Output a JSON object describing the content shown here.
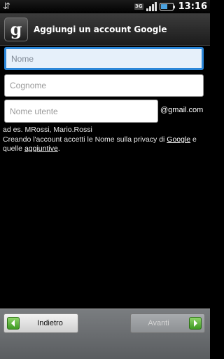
{
  "status_bar": {
    "usb_icon": "usb-icon",
    "network_badge": "3G",
    "time": "13:16",
    "battery_level": 0.6,
    "signal_bars": 4
  },
  "header": {
    "icon_letter": "g",
    "title": "Aggiungi un account Google"
  },
  "form": {
    "first_name": {
      "value": "",
      "placeholder": "Nome"
    },
    "last_name": {
      "value": "",
      "placeholder": "Cognome"
    },
    "username": {
      "value": "",
      "placeholder": "Nome utente"
    },
    "domain_suffix": "@gmail.com",
    "hint": "ad es. MRossi, Mario.Rossi",
    "terms_prefix": "Creando l'account accetti le Nome sulla privacy di ",
    "terms_link_google": "Google",
    "terms_middle": " e quelle ",
    "terms_link_additional": "aggiuntive",
    "terms_suffix": "."
  },
  "footer": {
    "back_label": "Indietro",
    "next_label": "Avanti"
  },
  "colors": {
    "focus_border": "#2a86d8",
    "arrow_green": "#3f9a23"
  }
}
